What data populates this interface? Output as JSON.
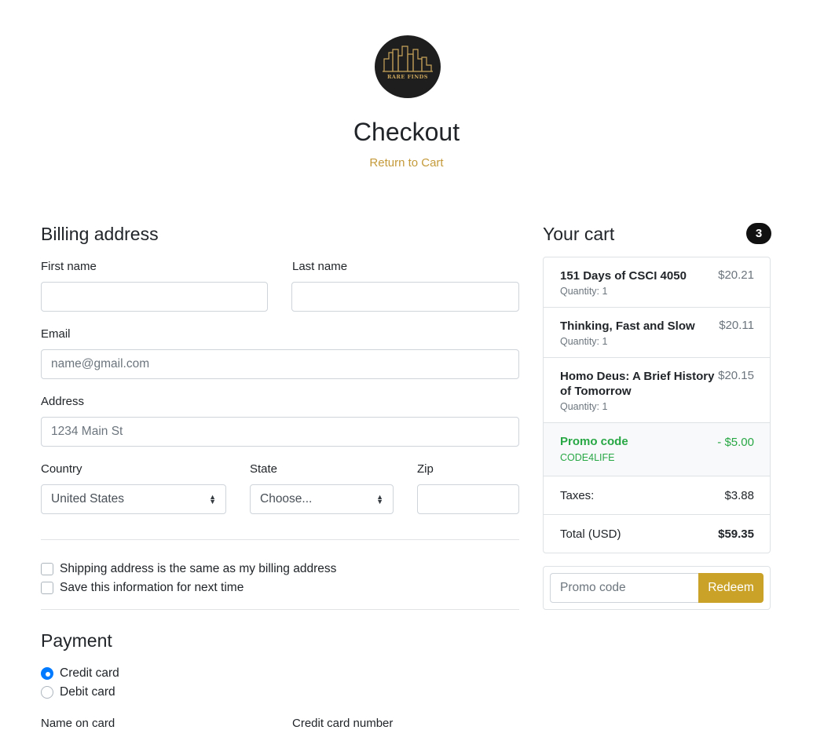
{
  "brand": {
    "logo_text": "RARE FINDS",
    "accent_color": "#c9a227",
    "link_color": "#c49a3a"
  },
  "header": {
    "title": "Checkout",
    "return_link": "Return to Cart"
  },
  "billing": {
    "heading": "Billing address",
    "first_name_label": "First name",
    "last_name_label": "Last name",
    "email_label": "Email",
    "email_placeholder": "name@gmail.com",
    "address_label": "Address",
    "address_placeholder": "1234 Main St",
    "country_label": "Country",
    "country_value": "United States",
    "state_label": "State",
    "state_value": "Choose...",
    "zip_label": "Zip",
    "same_address_label": "Shipping address is the same as my billing address",
    "save_info_label": "Save this information for next time"
  },
  "payment": {
    "heading": "Payment",
    "options": [
      {
        "label": "Credit card",
        "checked": true
      },
      {
        "label": "Debit card",
        "checked": false
      }
    ],
    "name_on_card_label": "Name on card",
    "card_number_label": "Credit card number"
  },
  "cart": {
    "heading": "Your cart",
    "count": "3",
    "items": [
      {
        "name": "151 Days of CSCI 4050",
        "sub": "Quantity: 1",
        "price": "$20.21"
      },
      {
        "name": "Thinking, Fast and Slow",
        "sub": "Quantity: 1",
        "price": "$20.11"
      },
      {
        "name": "Homo Deus: A Brief History of Tomorrow",
        "sub": "Quantity: 1",
        "price": "$20.15"
      }
    ],
    "promo": {
      "label": "Promo code",
      "code": "CODE4LIFE",
      "amount": "- $5.00"
    },
    "taxes_label": "Taxes:",
    "taxes_value": "$3.88",
    "total_label": "Total (USD)",
    "total_value": "$59.35"
  },
  "redeem": {
    "placeholder": "Promo code",
    "button_label": "Redeem"
  }
}
